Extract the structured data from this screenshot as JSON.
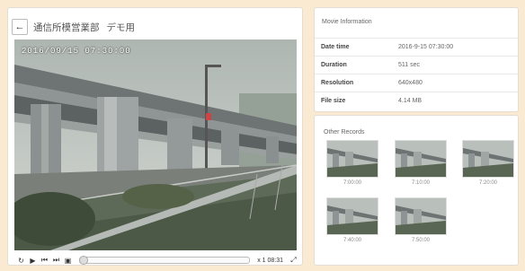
{
  "header": {
    "back_icon": "←",
    "camera_name": "通信所模営業部",
    "mode": "デモ用"
  },
  "video": {
    "osd_datetime": "2016/09/15  07:30:00"
  },
  "controls": {
    "time": "x 1 08:31"
  },
  "movie_info": {
    "title": "Movie Information",
    "rows": [
      {
        "label": "Date time",
        "value": "2016-9-15 07:30:00"
      },
      {
        "label": "Duration",
        "value": "511 sec"
      },
      {
        "label": "Resolution",
        "value": "640x480"
      },
      {
        "label": "File size",
        "value": "4.14 MB"
      }
    ]
  },
  "other_records": {
    "title": "Other Records",
    "items": [
      {
        "time": "7:00:00"
      },
      {
        "time": "7:10:00"
      },
      {
        "time": "7:20:00"
      },
      {
        "time": "7:40:00"
      },
      {
        "time": "7:50:00"
      }
    ]
  }
}
